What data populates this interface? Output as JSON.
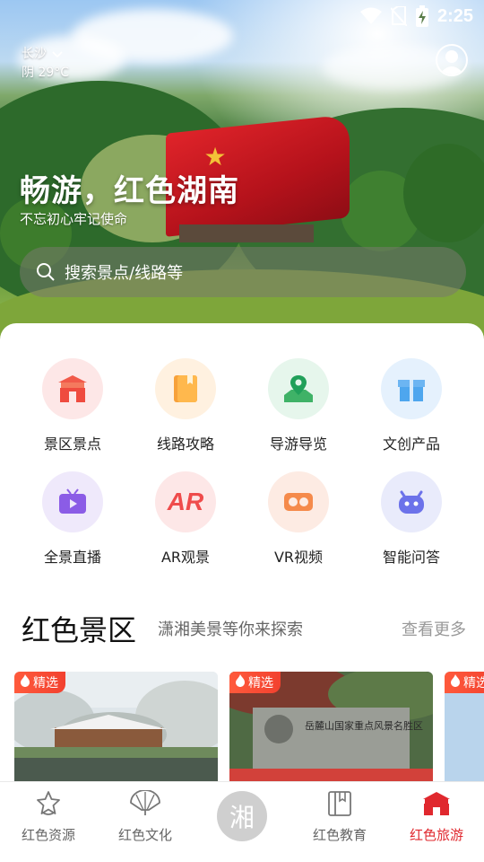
{
  "status_bar": {
    "time": "2:25"
  },
  "header": {
    "location": "长沙",
    "weather": "阴 29°C"
  },
  "hero": {
    "title": "畅游，红色湖南",
    "subtitle": "不忘初心牢记使命"
  },
  "search": {
    "placeholder": "搜索景点/线路等"
  },
  "quick_entries": [
    {
      "label": "景区景点",
      "icon": "scenic-gate-icon",
      "bg": "#fde7e7"
    },
    {
      "label": "线路攻略",
      "icon": "route-book-icon",
      "bg": "#fff1e0"
    },
    {
      "label": "导游导览",
      "icon": "map-pin-icon",
      "bg": "#e6f6ec"
    },
    {
      "label": "文创产品",
      "icon": "gift-box-icon",
      "bg": "#e5f1fd"
    },
    {
      "label": "全景直播",
      "icon": "live-tv-icon",
      "bg": "#efe9fb"
    },
    {
      "label": "AR观景",
      "icon": "ar-icon",
      "bg": "#fde7e7"
    },
    {
      "label": "VR视频",
      "icon": "vr-glasses-icon",
      "bg": "#fdebe3"
    },
    {
      "label": "智能问答",
      "icon": "robot-icon",
      "bg": "#e9ebfb"
    }
  ],
  "section": {
    "title": "红色景区",
    "subtitle": "潇湘美景等你来探索",
    "more": "查看更多"
  },
  "cards": [
    {
      "badge": "精选"
    },
    {
      "badge": "精选",
      "sign_text": "岳麓山国家重点风景名胜区"
    },
    {
      "badge": "精选"
    }
  ],
  "bottom_nav": [
    {
      "label": "红色资源",
      "icon": "star-badge-icon",
      "active": false
    },
    {
      "label": "红色文化",
      "icon": "fan-icon",
      "active": false
    },
    {
      "label": "湘",
      "icon": "xiang-center-icon",
      "active": false
    },
    {
      "label": "红色教育",
      "icon": "book-icon",
      "active": false
    },
    {
      "label": "红色旅游",
      "icon": "pavilion-icon",
      "active": true
    }
  ],
  "colors": {
    "accent": "#e0282e",
    "badge": "#f2412f"
  }
}
